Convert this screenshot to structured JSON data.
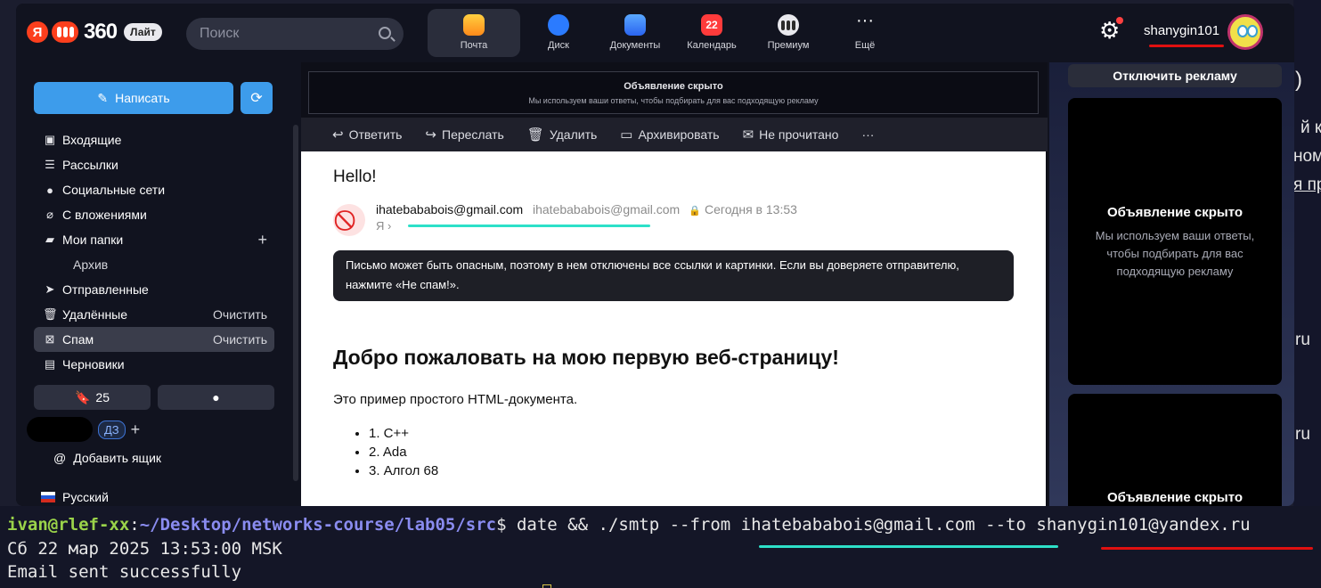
{
  "topbar": {
    "logo_num": "360",
    "logo_lite": "Лайт",
    "search_placeholder": "Поиск",
    "services": [
      {
        "label": "Почта",
        "icon": "mail-icon",
        "active": true
      },
      {
        "label": "Диск",
        "icon": "disk-icon"
      },
      {
        "label": "Документы",
        "icon": "docs-icon"
      },
      {
        "label": "Календарь",
        "icon": "calendar-icon",
        "badge": "22"
      },
      {
        "label": "Премиум",
        "icon": "premium-icon"
      },
      {
        "label": "Ещё",
        "icon": "more-icon"
      }
    ],
    "username": "shanygin101"
  },
  "sidebar": {
    "compose_label": "Написать",
    "folders": [
      {
        "label": "Входящие",
        "icon": "inbox-icon"
      },
      {
        "label": "Рассылки",
        "icon": "newsletters-icon"
      },
      {
        "label": "Социальные сети",
        "icon": "social-icon"
      },
      {
        "label": "С вложениями",
        "icon": "attachment-icon"
      },
      {
        "label": "Мои папки",
        "icon": "folder-icon",
        "action": "+"
      },
      {
        "label": "Архив",
        "sub": true
      },
      {
        "label": "Отправленные",
        "icon": "sent-icon"
      },
      {
        "label": "Удалённые",
        "icon": "trash-icon",
        "action": "Очистить"
      },
      {
        "label": "Спам",
        "icon": "spam-icon",
        "action": "Очистить",
        "active": true
      },
      {
        "label": "Черновики",
        "icon": "drafts-icon"
      }
    ],
    "bookmarks_count": "25",
    "account_badge": "ДЗ",
    "add_box_label": "Добавить ящик",
    "language": "Русский"
  },
  "ad_top": {
    "title": "Объявление скрыто",
    "text": "Мы используем ваши ответы, чтобы подбирать для вас подходящую рекламу"
  },
  "toolbar": {
    "reply": "Ответить",
    "forward": "Переслать",
    "delete": "Удалить",
    "archive": "Архивировать",
    "unread": "Не прочитано",
    "more": "···"
  },
  "message": {
    "subject": "Hello!",
    "from_name": "ihatebababois@gmail.com",
    "from_address": "ihatebababois@gmail.com",
    "date": "Сегодня в 13:53",
    "to": "Я",
    "warning": "Письмо может быть опасным, поэтому в нем отключены все ссылки и картинки. Если вы доверяете отправителю, нажмите «Не спам!».",
    "heading": "Добро пожаловать на мою первую веб-страницу!",
    "paragraph": "Это пример простого HTML-документа.",
    "list": [
      "1. C++",
      "2. Ada",
      "3. Алгол 68"
    ]
  },
  "right": {
    "disable_ads": "Отключить рекламу",
    "ad_title": "Объявление скрыто",
    "ad_text": "Мы используем ваши ответы, чтобы подбирать для вас подходящую рекламу",
    "ad_title_2": "Объявление скрыто"
  },
  "terminal": {
    "user_host": "ivan@rlef-xx",
    "path": "~/Desktop/networks-course/lab05/src",
    "command": "$ date && ./smtp --from ihatebababois@gmail.com --to shanygin101@yandex.ru",
    "line2": "Сб 22 мар 2025 13:53:00 MSK",
    "line3": "Email sent successfully"
  },
  "bg_fragments": [
    ")",
    "й к",
    "ном",
    "я пр",
    "ru",
    "ru"
  ],
  "colors": {
    "accent_blue": "#3d9ceb",
    "underline_red": "#e01010",
    "underline_cyan": "#2de0c8"
  }
}
